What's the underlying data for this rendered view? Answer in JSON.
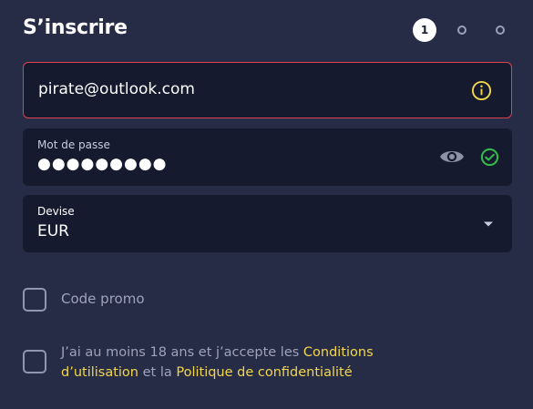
{
  "header": {
    "title": "S’inscrire",
    "steps": {
      "current": "1"
    }
  },
  "email_field": {
    "value": "pirate@outlook.com",
    "icon": "info-circle-icon",
    "border_color": "#e0424f"
  },
  "password_field": {
    "label": "Mot de passe",
    "masked_value": "●●●●●●●●●",
    "icons": [
      "eye-icon",
      "check-circle-icon"
    ]
  },
  "currency_field": {
    "label": "Devise",
    "value": "EUR"
  },
  "promo": {
    "label": "Code promo"
  },
  "terms": {
    "prefix": "J’ai au moins 18 ans et j’accepte les ",
    "link1": "Conditions d’utilisation",
    "middle": " et la ",
    "link2": "Politique de confidentialité"
  },
  "colors": {
    "background": "#272c46",
    "field_bg": "#151a2e",
    "accent_yellow": "#f2d64b",
    "success_green": "#34b84a",
    "error_red": "#e0424f"
  }
}
